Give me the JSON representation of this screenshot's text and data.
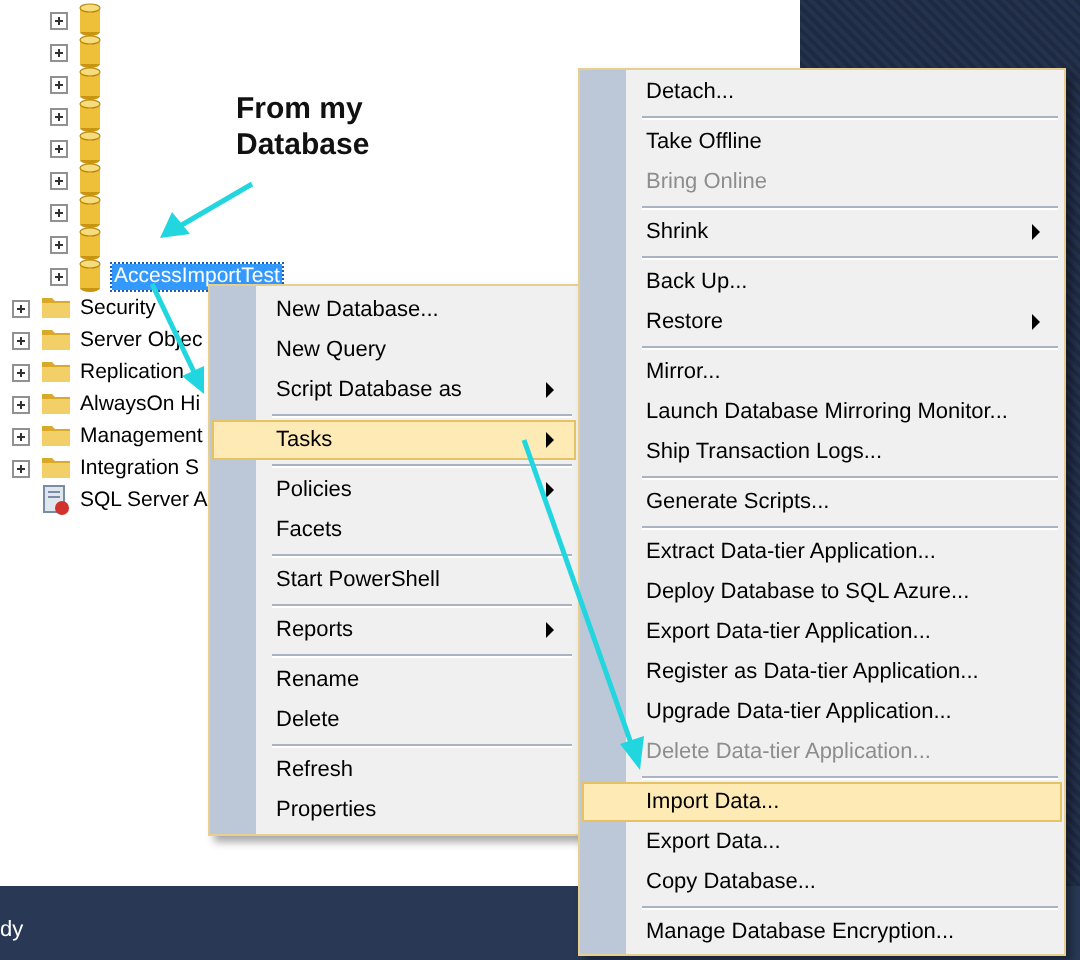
{
  "tree": {
    "database_nodes": [
      {
        "selected": false
      },
      {
        "selected": false
      },
      {
        "selected": false
      },
      {
        "selected": false
      },
      {
        "selected": false
      },
      {
        "selected": false
      },
      {
        "selected": false
      },
      {
        "selected": false
      },
      {
        "label": "AccessImportTest",
        "selected": true
      }
    ],
    "server_nodes": [
      {
        "kind": "folder",
        "label": "Security"
      },
      {
        "kind": "folder",
        "label": "Server Objec"
      },
      {
        "kind": "folder",
        "label": "Replication"
      },
      {
        "kind": "folder",
        "label": "AlwaysOn Hi"
      },
      {
        "kind": "folder",
        "label": "Management"
      },
      {
        "kind": "folder",
        "label": "Integration S"
      },
      {
        "kind": "agent",
        "label": "SQL Server A"
      }
    ]
  },
  "annotation": "From my\nDatabase",
  "context_menu": {
    "groups": [
      [
        {
          "label": "New Database...",
          "submenu": false,
          "disabled": false,
          "selected": false
        },
        {
          "label": "New Query",
          "submenu": false,
          "disabled": false,
          "selected": false
        },
        {
          "label": "Script Database as",
          "submenu": true,
          "disabled": false,
          "selected": false
        }
      ],
      [
        {
          "label": "Tasks",
          "submenu": true,
          "disabled": false,
          "selected": true
        }
      ],
      [
        {
          "label": "Policies",
          "submenu": true,
          "disabled": false,
          "selected": false
        },
        {
          "label": "Facets",
          "submenu": false,
          "disabled": false,
          "selected": false
        }
      ],
      [
        {
          "label": "Start PowerShell",
          "submenu": false,
          "disabled": false,
          "selected": false
        }
      ],
      [
        {
          "label": "Reports",
          "submenu": true,
          "disabled": false,
          "selected": false
        }
      ],
      [
        {
          "label": "Rename",
          "submenu": false,
          "disabled": false,
          "selected": false
        },
        {
          "label": "Delete",
          "submenu": false,
          "disabled": false,
          "selected": false
        }
      ],
      [
        {
          "label": "Refresh",
          "submenu": false,
          "disabled": false,
          "selected": false
        },
        {
          "label": "Properties",
          "submenu": false,
          "disabled": false,
          "selected": false
        }
      ]
    ]
  },
  "tasks_menu": {
    "groups": [
      [
        {
          "label": "Detach...",
          "submenu": false,
          "disabled": false,
          "selected": false
        }
      ],
      [
        {
          "label": "Take Offline",
          "submenu": false,
          "disabled": false,
          "selected": false
        },
        {
          "label": "Bring Online",
          "submenu": false,
          "disabled": true,
          "selected": false
        }
      ],
      [
        {
          "label": "Shrink",
          "submenu": true,
          "disabled": false,
          "selected": false
        }
      ],
      [
        {
          "label": "Back Up...",
          "submenu": false,
          "disabled": false,
          "selected": false
        },
        {
          "label": "Restore",
          "submenu": true,
          "disabled": false,
          "selected": false
        }
      ],
      [
        {
          "label": "Mirror...",
          "submenu": false,
          "disabled": false,
          "selected": false
        },
        {
          "label": "Launch Database Mirroring Monitor...",
          "submenu": false,
          "disabled": false,
          "selected": false
        },
        {
          "label": "Ship Transaction Logs...",
          "submenu": false,
          "disabled": false,
          "selected": false
        }
      ],
      [
        {
          "label": "Generate Scripts...",
          "submenu": false,
          "disabled": false,
          "selected": false
        }
      ],
      [
        {
          "label": "Extract Data-tier Application...",
          "submenu": false,
          "disabled": false,
          "selected": false
        },
        {
          "label": "Deploy Database to SQL Azure...",
          "submenu": false,
          "disabled": false,
          "selected": false
        },
        {
          "label": "Export Data-tier Application...",
          "submenu": false,
          "disabled": false,
          "selected": false
        },
        {
          "label": "Register as Data-tier Application...",
          "submenu": false,
          "disabled": false,
          "selected": false
        },
        {
          "label": "Upgrade Data-tier Application...",
          "submenu": false,
          "disabled": false,
          "selected": false
        },
        {
          "label": "Delete Data-tier Application...",
          "submenu": false,
          "disabled": true,
          "selected": false
        }
      ],
      [
        {
          "label": "Import Data...",
          "submenu": false,
          "disabled": false,
          "selected": true
        },
        {
          "label": "Export Data...",
          "submenu": false,
          "disabled": false,
          "selected": false
        },
        {
          "label": "Copy Database...",
          "submenu": false,
          "disabled": false,
          "selected": false
        }
      ],
      [
        {
          "label": "Manage Database Encryption...",
          "submenu": false,
          "disabled": false,
          "selected": false
        }
      ]
    ]
  },
  "status_bar": {
    "text": "dy"
  }
}
